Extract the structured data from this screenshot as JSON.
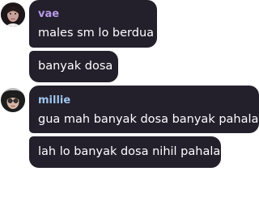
{
  "accent_colors": {
    "bubble_background": "#231f2b",
    "message_text": "#ffffff",
    "vae_name": "#b89be8",
    "millie_name": "#9ec5ee"
  },
  "messages": [
    {
      "sender": "vae",
      "avatar_icon": "user-avatar-icon",
      "lines": [
        "males sm lo berdua",
        "banyak dosa"
      ]
    },
    {
      "sender": "millie",
      "avatar_icon": "user-avatar-icon",
      "lines": [
        "gua mah banyak dosa banyak pahala",
        "lah lo banyak dosa nihil pahala"
      ]
    }
  ]
}
